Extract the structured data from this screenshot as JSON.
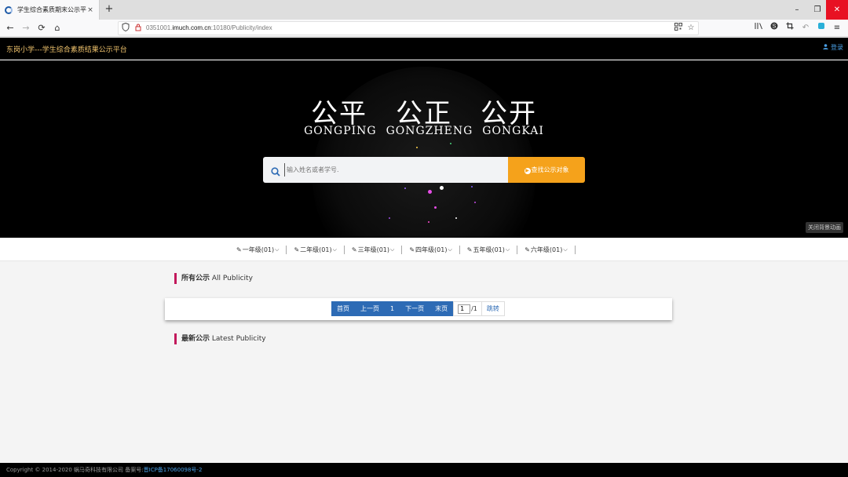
{
  "browser": {
    "tab_title": "学生综合素质期末公示平台",
    "tab_close": "×",
    "new_tab": "+",
    "window_controls": {
      "minimize": "–",
      "restore": "❐",
      "close": "✕"
    },
    "nav": {
      "back": "←",
      "forward": "→",
      "reload": "⟳",
      "home": "⌂"
    },
    "url_prefix": "0351001.",
    "url_domain": "imuch.com.cn",
    "url_rest": ":10180/Publicity/index",
    "icons": [
      "shield-icon",
      "lock-icon",
      "qr-icon",
      "star-icon",
      "library-icon",
      "extension-icon",
      "screenshot-icon",
      "undo-icon",
      "sync-icon",
      "menu-icon"
    ]
  },
  "header": {
    "site_title": "东岗小学---学生综合素质结果公示平台",
    "login": "登录"
  },
  "hero": {
    "slogan": [
      "公平",
      "公正",
      "公开"
    ],
    "pinyin": [
      "GONGPING",
      "GONGZHENG",
      "GONGKAI"
    ],
    "search_placeholder": "输入姓名或者学号.",
    "search_button": "查找公示对象",
    "bg_toggle": "关闭背景动画"
  },
  "grades": [
    {
      "label": "一年级(01)"
    },
    {
      "label": "二年级(01)"
    },
    {
      "label": "三年级(01)"
    },
    {
      "label": "四年级(01)"
    },
    {
      "label": "五年级(01)"
    },
    {
      "label": "六年级(01)"
    }
  ],
  "sections": {
    "all_cn": "所有公示",
    "all_en": "All Publicity",
    "latest_cn": "最新公示",
    "latest_en": "Latest Publicity"
  },
  "pager": {
    "first": "首页",
    "prev": "上一页",
    "current": "1",
    "next": "下一页",
    "last": "末页",
    "input_value": "1",
    "total": "/1",
    "jump": "跳转"
  },
  "footer": {
    "copyright": "Copyright © 2014-2020 蜗马奇科技有限公司 备案号:",
    "icp": "晋ICP备17060098号-2"
  },
  "colors": {
    "accent_orange": "#f5a21b",
    "pager_blue": "#2d6bb5",
    "section_bar": "#c2185b",
    "title_gold": "#f0c36d"
  }
}
